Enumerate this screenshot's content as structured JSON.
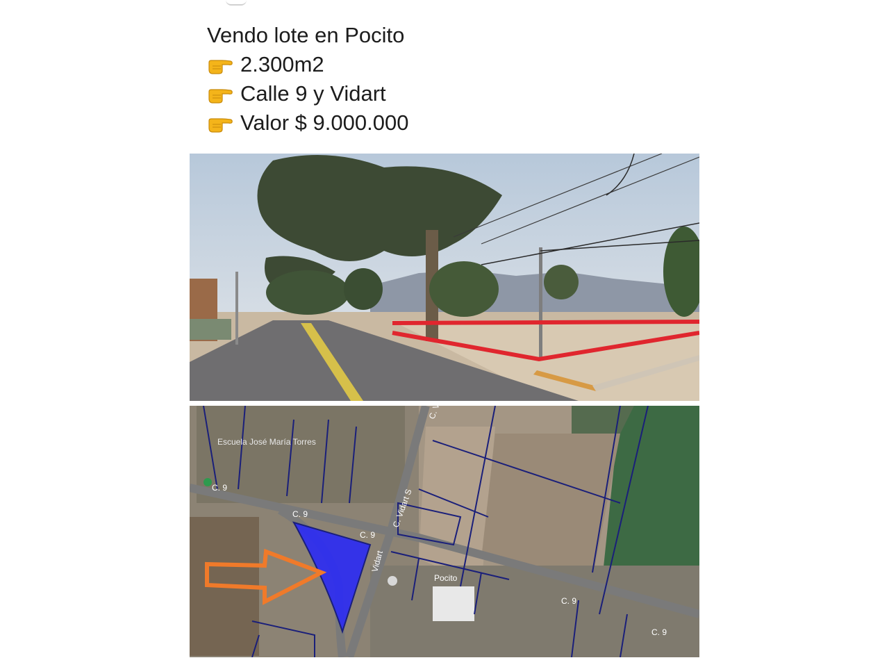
{
  "post": {
    "title": "Vendo lote en Pocito",
    "bullets": [
      {
        "icon": "pointing-hand-icon",
        "text": "2.300m2"
      },
      {
        "icon": "pointing-hand-icon",
        "text": "Calle 9 y Vidart"
      },
      {
        "icon": "pointing-hand-icon",
        "text": "Valor $ 9.000.000"
      }
    ]
  },
  "map_labels": {
    "school": "Escuela José María Torres",
    "street_c9_a": "C. 9",
    "street_c9_b": "C. 9",
    "street_vidart": "C. Vidart S",
    "street_vidart_short": "Vidart",
    "street_c9_c": "C. 9",
    "pocito": "Pocito",
    "street_c9_d": "C. 9",
    "marker_c9": "C. 9",
    "c9_top": "C. Vi"
  },
  "colors": {
    "lot_outline_photo": "#e0262e",
    "lot_fill_map": "#2a2af5",
    "arrow": "#f07a2a",
    "parcel_lines": "#1a1f7a"
  }
}
